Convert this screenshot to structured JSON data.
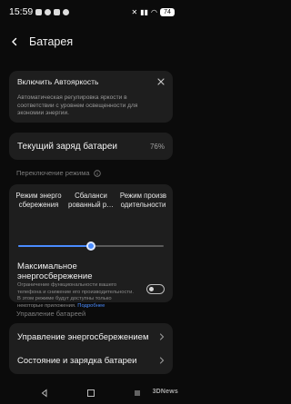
{
  "status_bar": {
    "time": "15:59",
    "battery": "74"
  },
  "header": {
    "title": "Батарея"
  },
  "notice": {
    "title": "Включить Автояркость",
    "text": "Автоматическая регулировка яркости в соответствии с уровнем освещенности для экономии энергии."
  },
  "charge": {
    "label": "Текущий заряд батареи",
    "value": "76%"
  },
  "mode_section": {
    "label": "Переключение режима"
  },
  "modes": {
    "items": [
      {
        "label": "Режим энерго сбережения"
      },
      {
        "label": "Сбаланси рованный р…"
      },
      {
        "label": "Режим произв одительности"
      }
    ],
    "selected_index": 1,
    "slider_level": 0.5
  },
  "max_saving": {
    "title": "Максимальное энергосбережение",
    "description": "Ограничение функциональности вашего телефона и снижение его производительности. В этом режиме будут доступны только некоторые приложения.",
    "link": "Подробнее",
    "enabled": false
  },
  "management_section": {
    "label": "Управление батареей"
  },
  "management": {
    "items": [
      {
        "label": "Управление энергосбережением"
      },
      {
        "label": "Состояние и зарядка батареи"
      }
    ]
  },
  "watermark": "3DNews",
  "colors": {
    "accent": "#4a8cff",
    "card": "#1e1e1e",
    "background": "#0b0b0b"
  }
}
